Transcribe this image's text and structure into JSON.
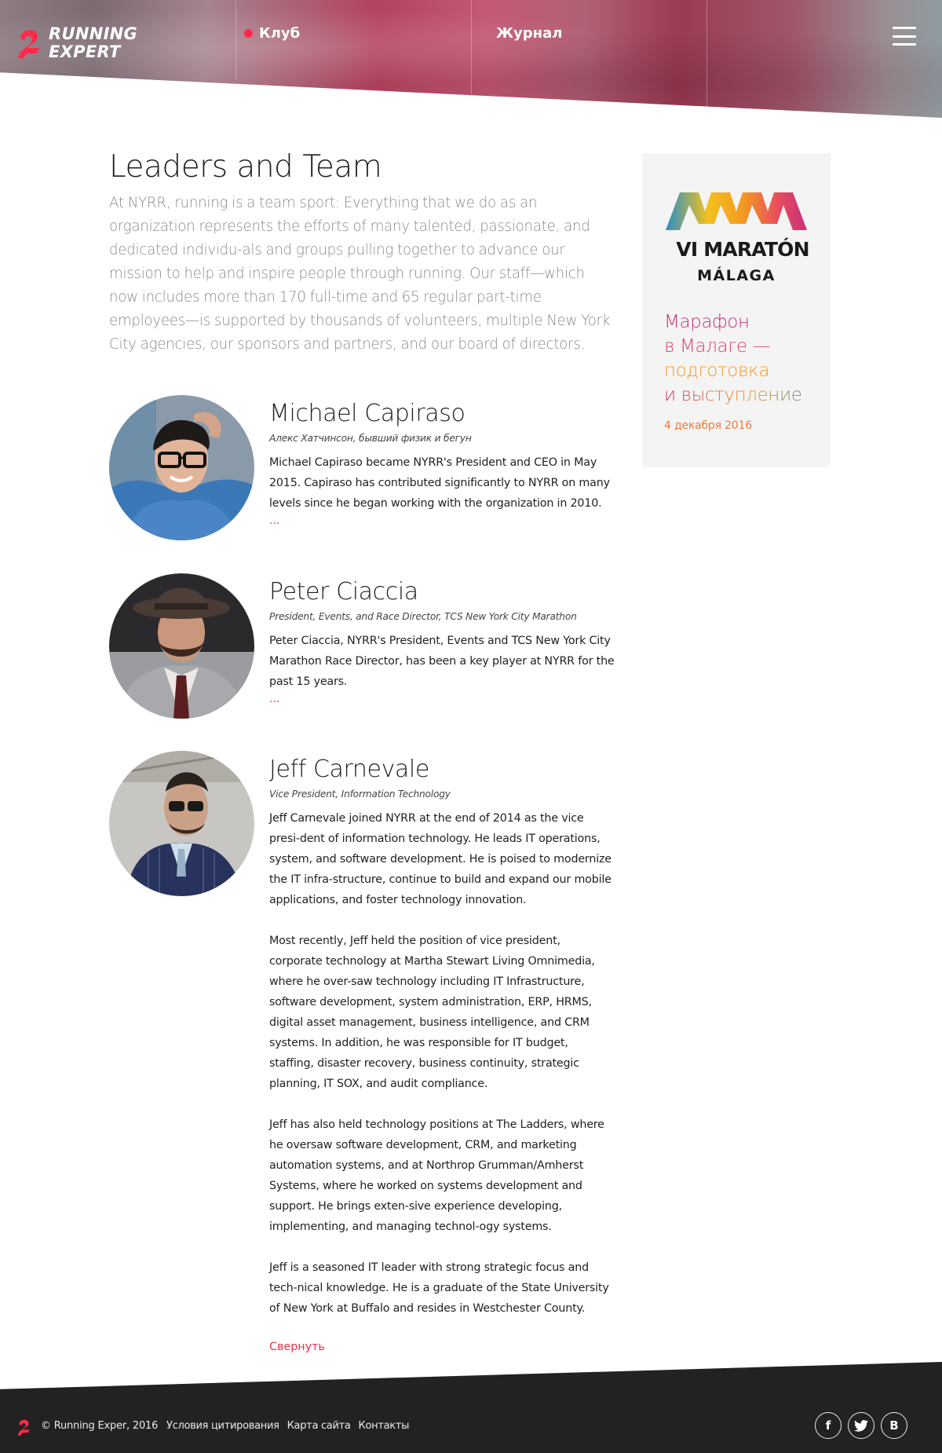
{
  "header": {
    "logo_line1": "RUNNING",
    "logo_line2": "EXPERT",
    "nav": {
      "club": "Клуб",
      "journal": "Журнал"
    },
    "menu_icon": "hamburger-menu-icon",
    "colors": {
      "nav_dot": "#ff2a4a"
    }
  },
  "main": {
    "title": "Leaders and Team",
    "intro": "At NYRR, running is a team sport: Everything that we do as an organization represents the efforts of many talented, passionate, and dedicated individu-als and groups pulling together to advance our mission to help and inspire people through running. Our staff—which now includes more than 170 full-time and 65 regular part-time employees—is supported by thousands of volunteers, multiple New York City agencies, our sponsors and partners, and our board of directors.",
    "people": [
      {
        "name": "Michael Capiraso",
        "role": "Алекс Хатчинсон, бывший физик и бегун",
        "bio": [
          "Michael Capiraso became NYRR's President and CEO in May 2015. Capiraso has contributed significantly to NYRR on many levels since he began working with the organization in 2010."
        ],
        "more": "..."
      },
      {
        "name": "Peter Ciaccia",
        "role": "President, Events, and Race Director, TCS New York City Marathon",
        "bio": [
          "Peter Ciaccia, NYRR's President, Events and TCS New York City Marathon Race Director, has been a key player at NYRR for the past 15 years."
        ],
        "more": "..."
      },
      {
        "name": "Jeff Carnevale",
        "role": "Vice President, Information Technology",
        "bio": [
          "Jeff Carnevale joined NYRR at the end of 2014 as the vice presi-dent of information technology. He leads IT operations, system, and software development. He is poised to modernize the IT infra-structure, continue to build and expand our mobile applications, and foster technology innovation.",
          "Most recently, Jeff held the position of vice president, corporate technology at Martha Stewart Living Omnimedia, where he over-saw technology including IT Infrastructure, software development, system administration, ERP, HRMS, digital asset management, business intelligence, and CRM systems. In addition, he was responsible for IT budget, staffing, disaster recovery, business continuity, strategic planning, IT SOX, and audit compliance.",
          "Jeff has also held technology positions at The Ladders, where he oversaw software development, CRM, and marketing automation systems, and at Northrop Grumman/Amherst Systems, where he worked on systems development and support. He brings exten-sive experience developing, implementing, and managing technol-ogy systems.",
          "Jeff is a seasoned IT leader with strong strategic focus and tech-nical knowledge. He is a graduate of the State University of New York at Buffalo and resides in Westchester County."
        ],
        "collapse": "Свернуть"
      }
    ]
  },
  "ad": {
    "event_title": "VI MARATÓN",
    "event_city": "MÁLAGA",
    "headline": [
      "Марафон",
      "в Малаге —",
      "подготовка",
      "и выступление"
    ],
    "date": "4 декабря 2016",
    "colors": {
      "magenta": "#c8307a",
      "orange": "#f29a21",
      "blue": "#2a8fc7",
      "yellow": "#f4c01e"
    }
  },
  "footer": {
    "copyright": "© Running Exper, 2016",
    "links": [
      "Условия цитирования",
      "Карта сайта",
      "Контакты"
    ],
    "social": {
      "facebook": "f",
      "vk": "В"
    }
  }
}
